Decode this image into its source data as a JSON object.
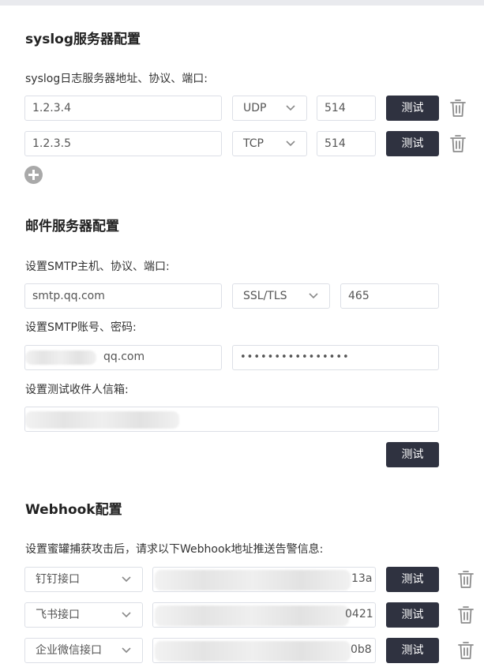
{
  "syslog": {
    "title": "syslog服务器配置",
    "label": "syslog日志服务器地址、协议、端口:",
    "rows": [
      {
        "address": "1.2.3.4",
        "protocol": "UDP",
        "port": "514",
        "test_label": "测试"
      },
      {
        "address": "1.2.3.5",
        "protocol": "TCP",
        "port": "514",
        "test_label": "测试"
      }
    ]
  },
  "mail": {
    "title": "邮件服务器配置",
    "smtp_label": "设置SMTP主机、协议、端口:",
    "host": "smtp.qq.com",
    "protocol": "SSL/TLS",
    "port": "465",
    "account_label": "设置SMTP账号、密码:",
    "account_suffix": "qq.com",
    "password": "••••••••••••••••",
    "recipient_label": "设置测试收件人信箱:",
    "test_label": "测试"
  },
  "webhook": {
    "title": "Webhook配置",
    "label": "设置蜜罐捕获攻击后，请求以下Webhook地址推送告警信息:",
    "rows": [
      {
        "type": "钉钉接口",
        "url_suffix": "13a",
        "test_label": "测试"
      },
      {
        "type": "飞书接口",
        "url_suffix": "0421",
        "test_label": "测试"
      },
      {
        "type": "企业微信接口",
        "url_suffix": "0b8",
        "test_label": "测试"
      }
    ]
  },
  "colors": {
    "button_bg": "#2f3240",
    "border": "#dcdfe6",
    "add_icon": "#a9a9a9"
  }
}
